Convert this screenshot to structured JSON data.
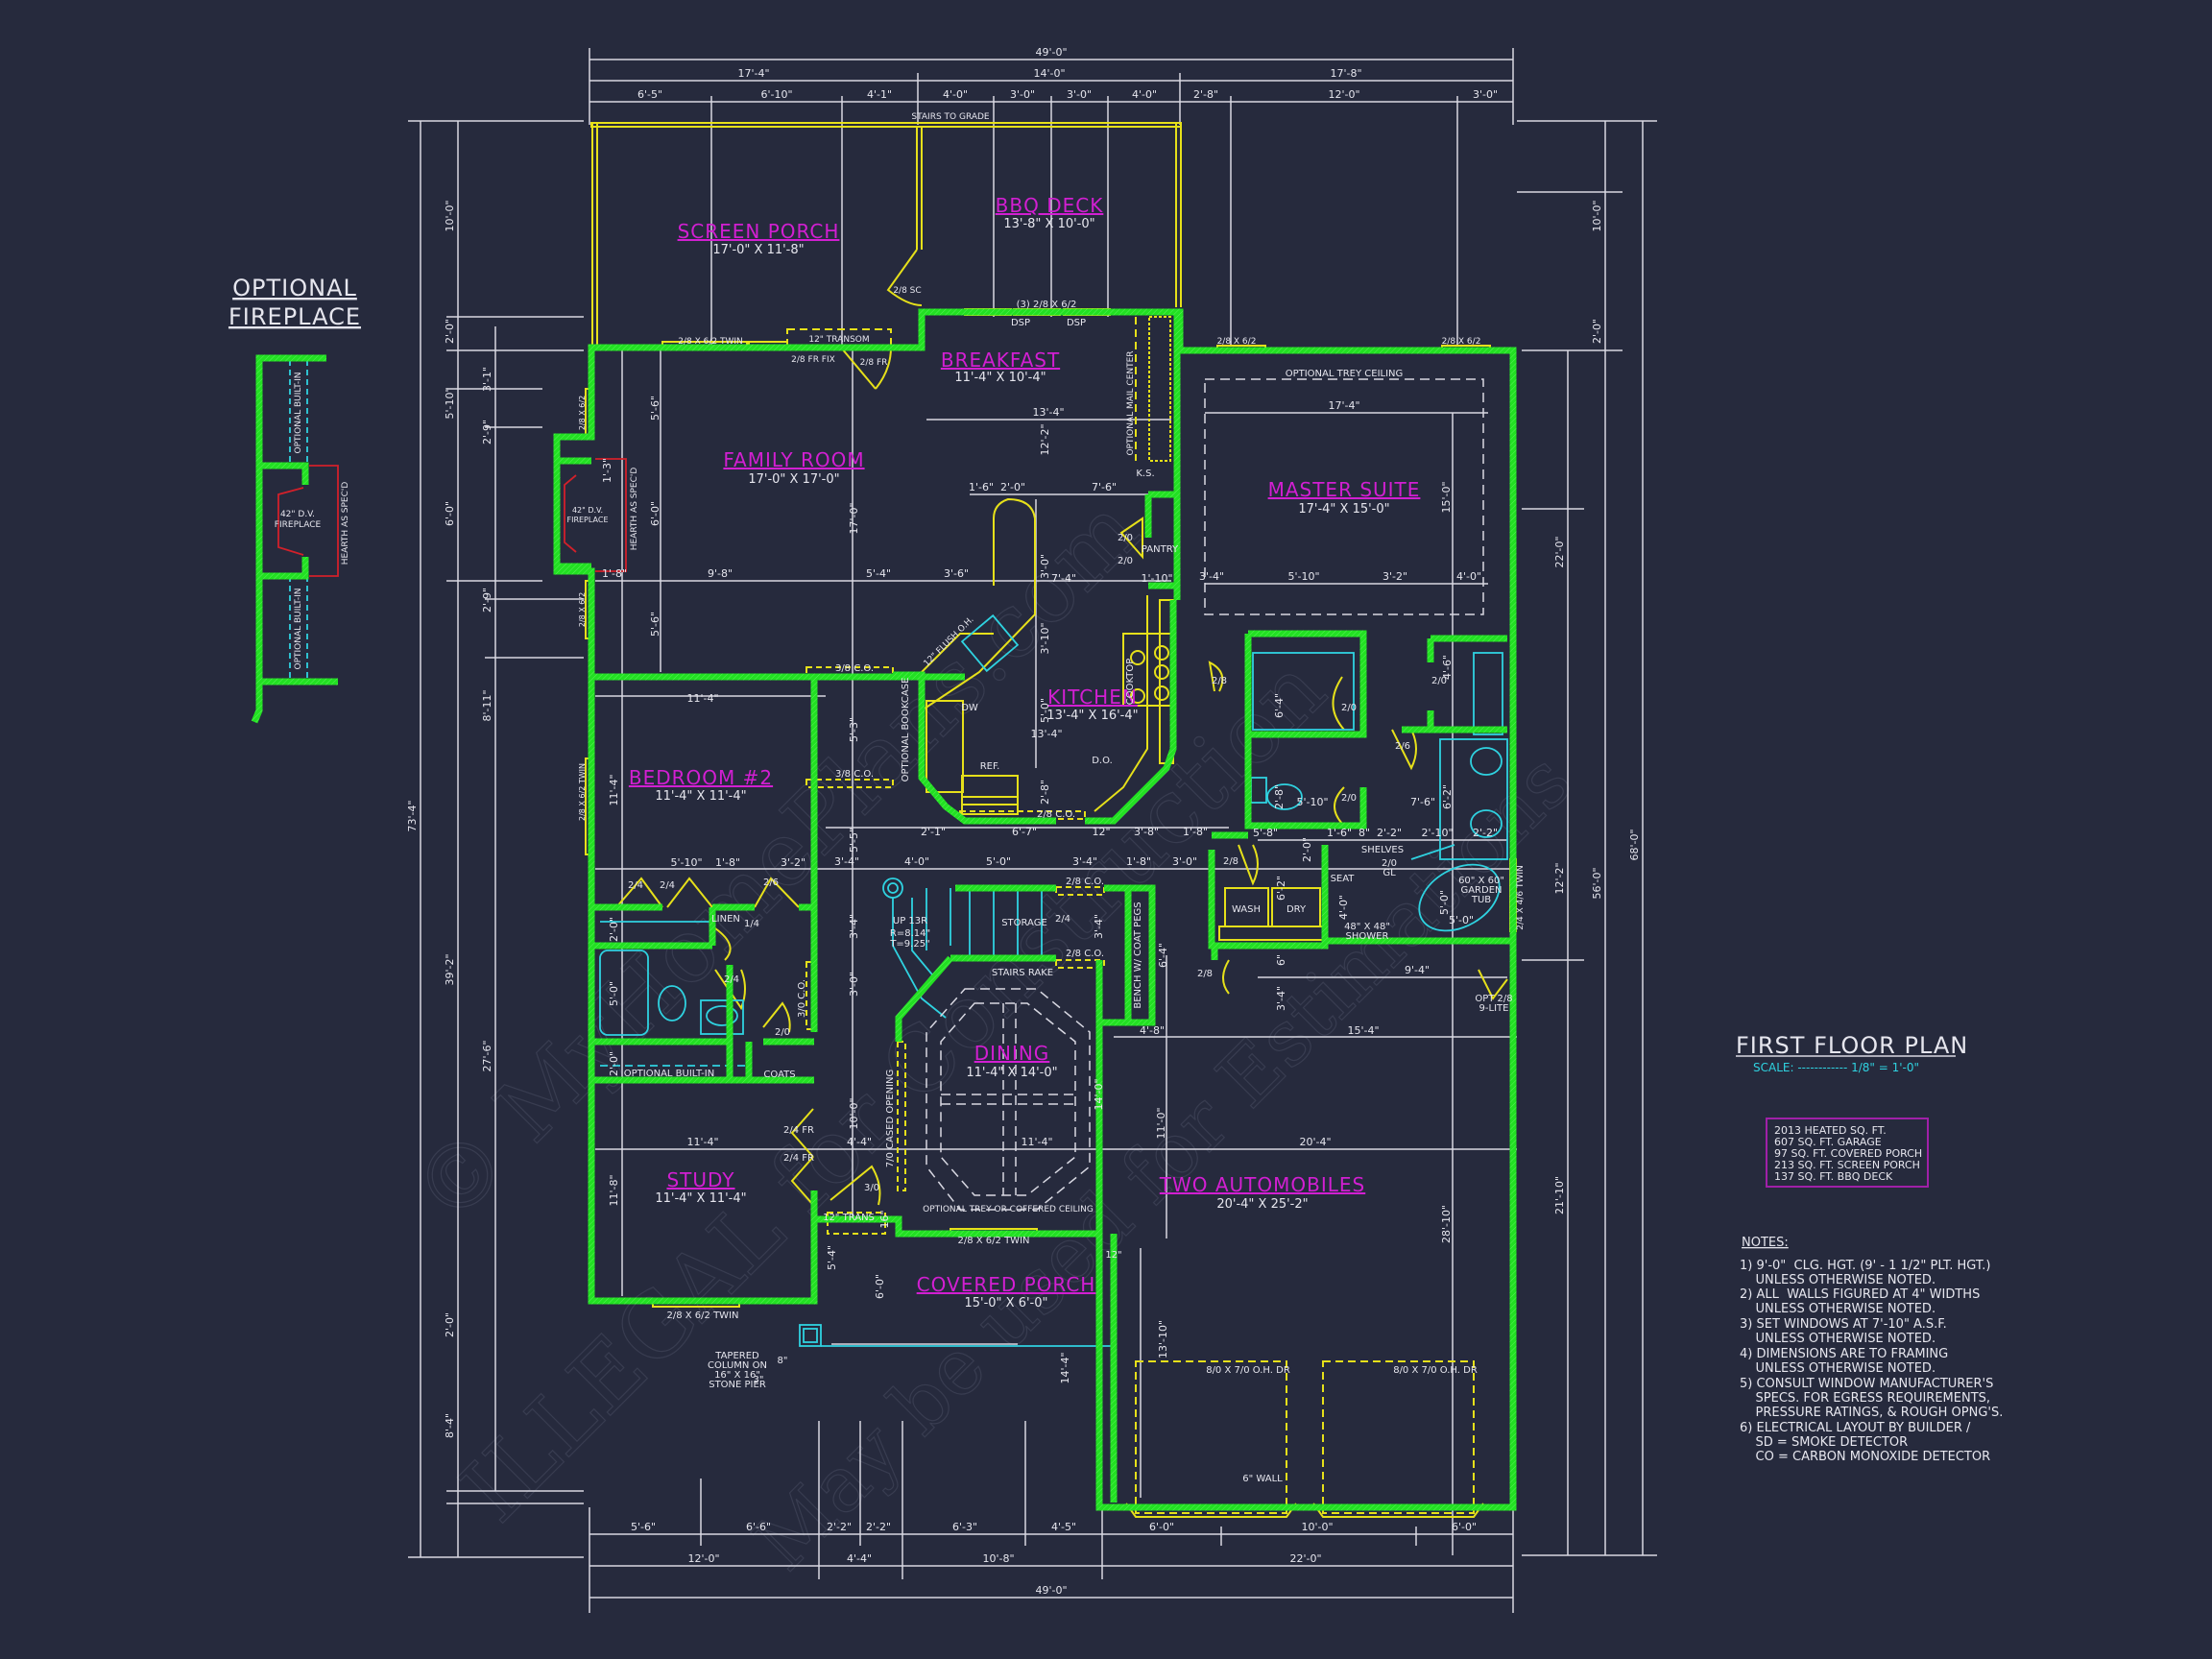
{
  "sheet": {
    "title": "FIRST FLOOR PLAN",
    "scale": "SCALE: ------------ 1/8\" = 1'-0\"",
    "colors": {
      "background": "#262a3d",
      "wall": "#22e022",
      "window_door": "#e6e01a",
      "fixture": "#2fd2e0",
      "room_label": "#d21fd2",
      "dimension": "#e6e6ee",
      "hearth": "#d2202a",
      "watermark": "#5a5f74"
    }
  },
  "optional_fireplace": {
    "title_line1": "OPTIONAL",
    "title_line2": "FIREPLACE",
    "builtin_label": "OPTIONAL BUILT-IN",
    "fireplace_line1": "42\" D.V.",
    "fireplace_line2": "FIREPLACE",
    "hearth_label": "HEARTH AS SPEC'D"
  },
  "rooms": [
    {
      "name": "SCREEN PORCH",
      "size": "17'-0\" X 11'-8\""
    },
    {
      "name": "BBQ DECK",
      "size": "13'-8\" X 10'-0\""
    },
    {
      "name": "BREAKFAST",
      "size": "11'-4\" X 10'-4\""
    },
    {
      "name": "FAMILY ROOM",
      "size": "17'-0\" X 17'-0\""
    },
    {
      "name": "MASTER SUITE",
      "size": "17'-4\" X 15'-0\""
    },
    {
      "name": "KITCHEN",
      "size": "13'-4\" X 16'-4\""
    },
    {
      "name": "BEDROOM #2",
      "size": "11'-4\" X 11'-4\""
    },
    {
      "name": "DINING",
      "size": "11'-4\" X 14'-0\""
    },
    {
      "name": "STUDY",
      "size": "11'-4\" X 11'-4\""
    },
    {
      "name": "COVERED PORCH",
      "size": "15'-0\" X 6'-0\""
    },
    {
      "name": "TWO AUTOMOBILES",
      "size": "20'-4\" X 25'-2\""
    }
  ],
  "labels": {
    "stairs_to_grade": "STAIRS TO GRADE",
    "screen_door": "2/8 SC",
    "deck_doors": "(3) 2/8 X 6/2",
    "dsp1": "DSP",
    "dsp2": "DSP",
    "family_twin": "2/8 X 6/2 TWIN",
    "transom": "12\" TRANSOM",
    "fr_fix": "2/8 FR FIX",
    "fr": "2/8 FR",
    "master_win1": "2/8 X 6/2",
    "master_win2": "2/8 X 6/2",
    "trey_ceiling": "OPTIONAL TREY CEILING",
    "mail_center": "OPTIONAL MAIL CENTER",
    "ks": "K.S.",
    "pantry": "PANTRY",
    "pantry_door1": "2/0",
    "pantry_door2": "2/0",
    "flush_oh": "12\" FLUSH O.H.",
    "dw": "DW",
    "ref": "REF.",
    "cooktop": "COOKTOP",
    "do": "D.O.",
    "co_38_1": "3/8 C.O.",
    "co_38_2": "3/8 C.O.",
    "co_28": "2/8 C.O.",
    "bookcase": "OPTIONAL BOOKCASE",
    "fireplace_main1": "42\" D.V.",
    "fireplace_main2": "FIREPLACE",
    "hearth_main": "HEARTH AS SPEC'D",
    "win_fam1": "2/8 X 6/2",
    "win_fam2": "2/8 X 6/2",
    "win_bed": "2/8 X 6/2 TWIN",
    "closet_2_4a": "2/4",
    "closet_2_4b": "2/4",
    "door_2_6": "2/6",
    "linen": "LINEN",
    "linen_door": "1/4",
    "bath_door": "2/4",
    "co_30": "3/0 C.O.",
    "coats_door": "2/0",
    "builtin": "OPTIONAL BUILT-IN",
    "coats": "COATS",
    "study_fr1": "2/4 FR",
    "study_fr2": "2/4 FR",
    "entry_door": "3/0",
    "trans": "12\" TRANS",
    "study_twin": "2/8 X 6/2 TWIN",
    "dining_twin": "2/8 X 6/2 TWIN",
    "cased_opening": "7/0 CASED OPENING",
    "coffered": "OPTIONAL TREY OR COFFERED CEILING",
    "stairs_up": "UP 13R",
    "riser": "R=8.14\"",
    "tread": "T=9.25\"",
    "storage": "STORAGE",
    "storage_door": "2/4",
    "co_28a": "2/8 C.O.",
    "co_28b": "2/8 C.O.",
    "stairs_rake": "STAIRS RAKE",
    "bench": "BENCH W/ COAT PEGS",
    "laundry_door": "2/8",
    "garage_door": "2/8",
    "wash": "WASH",
    "dry": "DRY",
    "shelves": "SHELVES",
    "shower_door1": "2/0",
    "shower_door2": "GL",
    "seat": "SEAT",
    "shower1": "48\" X 48\"",
    "shower2": "SHOWER",
    "tub1": "60\" X 60\"",
    "tub2": "GARDEN",
    "tub3": "TUB",
    "tub_win": "2/4 X 4/6 TWIN",
    "wic_door1": "2/0",
    "wic_door2": "2/0",
    "bath_door_26": "2/6",
    "wc_door": "2/0",
    "master_door": "2/8",
    "opt_door1": "OPT 2/8",
    "opt_door2": "9-LITE",
    "garage_oh1": "8/0 X 7/0 O.H. DR",
    "garage_oh2": "8/0 X 7/0 O.H. DR",
    "six_wall": "6\" WALL",
    "column1": "TAPERED",
    "column2": "COLUMN ON",
    "column3": "16\" X 16\"",
    "column4": "STONE PIER",
    "col_8": "8\"",
    "col_3": "3\"",
    "twelve": "12\""
  },
  "dimensions": {
    "top_overall": "49'-0\"",
    "top_mid": [
      "17'-4\"",
      "14'-0\"",
      "17'-8\""
    ],
    "top_detail": [
      "6'-5\"",
      "6'-10\"",
      "4'-1\"",
      "4'-0\"",
      "3'-0\"",
      "3'-0\"",
      "4'-0\"",
      "2'-8\"",
      "12'-0\"",
      "3'-0\""
    ],
    "bottom_detail": [
      "5'-6\"",
      "6'-6\"",
      "2'-2\"",
      "2'-2\"",
      "6'-3\"",
      "4'-5\"",
      "6'-0\"",
      "10'-0\"",
      "6'-0\""
    ],
    "bottom_mid": [
      "12'-0\"",
      "4'-4\"",
      "10'-8\"",
      "22'-0\""
    ],
    "bottom_overall": "49'-0\"",
    "left_overall": "73'-4\"",
    "left_mid": [
      "10'-0\"",
      "2'-0\"",
      "5'-10\"",
      "6'-0\"",
      "39'-2\"",
      "2'-0\"",
      "8'-4\""
    ],
    "left_inner": [
      "3'-1\"",
      "2'-9\"",
      "2'-9\"",
      "8'-11\"",
      "27'-6\""
    ],
    "right_overall": "68'-0\"",
    "right_mid": [
      "10'-0\"",
      "2'-0\"",
      "56'-0\""
    ],
    "right_inner": [
      "22'-0\"",
      "12'-2\"",
      "21'-10\""
    ],
    "interior": {
      "fam_v1": "5'-6\"",
      "fam_v2": "6'-0\"",
      "fam_v3": "5'-6\"",
      "fam_h1": "1'-8\"",
      "fam_h2": "9'-8\"",
      "fam_h3": "5'-4\"",
      "fam_h4": "3'-6\"",
      "fam_17": "17'-0\"",
      "fam_13": "1'-3\"",
      "bk_13_4": "13'-4\"",
      "bk_12_2": "12'-2\"",
      "k_1_6": "1'-6\"",
      "k_2_0": "2'-0\"",
      "k_7_6": "7'-6\"",
      "k_7_4": "7'-4\"",
      "k_1_10": "1'-10\"",
      "k_3_0": "3'-0\"",
      "k_3_10": "3'-10\"",
      "k_5_0": "5'-0\"",
      "k_13_4": "13'-4\"",
      "k_2_8": "2'-8\"",
      "k_5_3": "5'-3\"",
      "k_5_5": "5'-5\"",
      "m_17_4": "17'-4\"",
      "m_15_0": "15'-0\"",
      "m_3_4": "3'-4\"",
      "m_5_10": "5'-10\"",
      "m_3_2": "3'-2\"",
      "m_4_0": "4'-0\"",
      "b_11_4h": "11'-4\"",
      "b_11_4v": "11'-4\"",
      "b_5_10": "5'-10\"",
      "b_1_8": "1'-8\"",
      "b_3_2": "3'-2\"",
      "b_2_0a": "2'-0\"",
      "b_5_0": "5'-0\"",
      "b_2_0b": "2'-0\"",
      "r_2_1": "2'-1\"",
      "r_6_7": "6'-7\"",
      "r_12": "12\"",
      "r_3_8": "3'-8\"",
      "r_1_8": "1'-8\"",
      "s_3_4": "3'-4\"",
      "s_4_0": "4'-0\"",
      "s_5_0": "5'-0\"",
      "s_3_4b": "3'-4\"",
      "s_1_8": "1'-8\"",
      "s_3_0": "3'-0\"",
      "s_3_4v": "3'-4\"",
      "s_3_0v": "3'-0\"",
      "s_10_0": "10'-0\"",
      "s_3_4r": "3'-4\"",
      "s_6_4": "6'-4\"",
      "d_4_4": "4'-4\"",
      "d_11_4": "11'-4\"",
      "d_14_0": "14'-0\"",
      "d_11_0": "11'-0\"",
      "d_4_8": "4'-8\"",
      "st_11_4": "11'-4\"",
      "st_11_8": "11'-8\"",
      "p_5_4": "5'-4\"",
      "p_6_0": "6'-0\"",
      "p_14_4": "14'-4\"",
      "p_16": "16\"",
      "g_20_4": "20'-4\"",
      "g_28_10": "28'-10\"",
      "g_13_10": "13'-10\"",
      "g_15_4": "15'-4\"",
      "g_9_4": "9'-4\"",
      "mb_6_4": "6'-4\"",
      "mb_4_6": "4'-6\"",
      "mb_2_8": "2'-8\"",
      "mb_5_10": "5'-10\"",
      "mb_7_6": "7'-6\"",
      "mb_6_2": "6'-2\"",
      "mb_5_8": "5'-8\"",
      "mb_1_6": "1'-6\"",
      "mb_8": "8\"",
      "mb_2_2": "2'-2\"",
      "mb_2_10": "2'-10\"",
      "mb_2_2b": "2'-2\"",
      "mb_2_0": "2'-0\"",
      "mb_6_2b": "6'-2\"",
      "mb_4_0": "4'-0\"",
      "mb_5_0a": "5'-0\"",
      "mb_5_0b": "5'-0\"",
      "mb_6": "6\"",
      "mb_3_4": "3'-4\""
    }
  },
  "area_summary": [
    "2013 HEATED SQ. FT.",
    "607 SQ. FT. GARAGE",
    "97 SQ. FT. COVERED PORCH",
    "213 SQ. FT. SCREEN PORCH",
    "137 SQ. FT. BBQ DECK"
  ],
  "notes": {
    "heading": "NOTES:",
    "lines": [
      "1) 9'-0\"  CLG. HGT. (9' - 1 1/2\" PLT. HGT.)",
      "    UNLESS OTHERWISE NOTED.",
      "2) ALL  WALLS FIGURED AT 4\" WIDTHS",
      "    UNLESS OTHERWISE NOTED.",
      "3) SET WINDOWS AT 7'-10\" A.S.F.",
      "    UNLESS OTHERWISE NOTED.",
      "4) DIMENSIONS ARE TO FRAMING",
      "    UNLESS OTHERWISE NOTED.",
      "5) CONSULT WINDOW MANUFACTURER'S",
      "    SPECS. FOR EGRESS REQUIREMENTS,",
      "    PRESSURE RATINGS, & ROUGH OPNG'S.",
      "6) ELECTRICAL LAYOUT BY BUILDER /",
      "    SD = SMOKE DETECTOR",
      "    CO = CARBON MONOXIDE DETECTOR"
    ]
  },
  "watermark": {
    "line1": "© MyHomePlans.com",
    "line2": "ILLEGAL for Construction",
    "line3": "May be used for Estimations"
  }
}
